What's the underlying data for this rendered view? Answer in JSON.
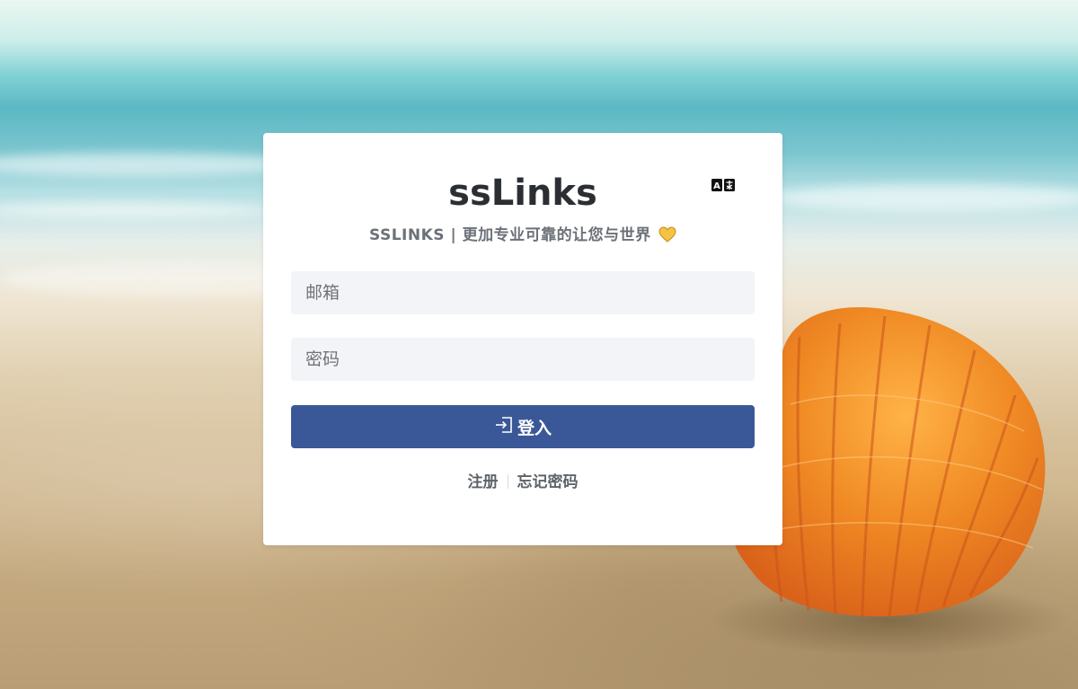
{
  "app": {
    "title": "ssLinks",
    "subtitle": "SSLINKS | 更加专业可靠的让您与世界"
  },
  "icons": {
    "translate": "translate-icon",
    "heart": "yellow-heart-icon",
    "login": "sign-in-icon"
  },
  "form": {
    "email_placeholder": "邮箱",
    "password_placeholder": "密码",
    "login_label": "登入"
  },
  "links": {
    "register": "注册",
    "forgot_password": "忘记密码"
  },
  "colors": {
    "primary_button": "#3a5897",
    "input_background": "#f3f4f7",
    "title_text": "#2b2f33",
    "subtitle_text": "#6b7178"
  }
}
